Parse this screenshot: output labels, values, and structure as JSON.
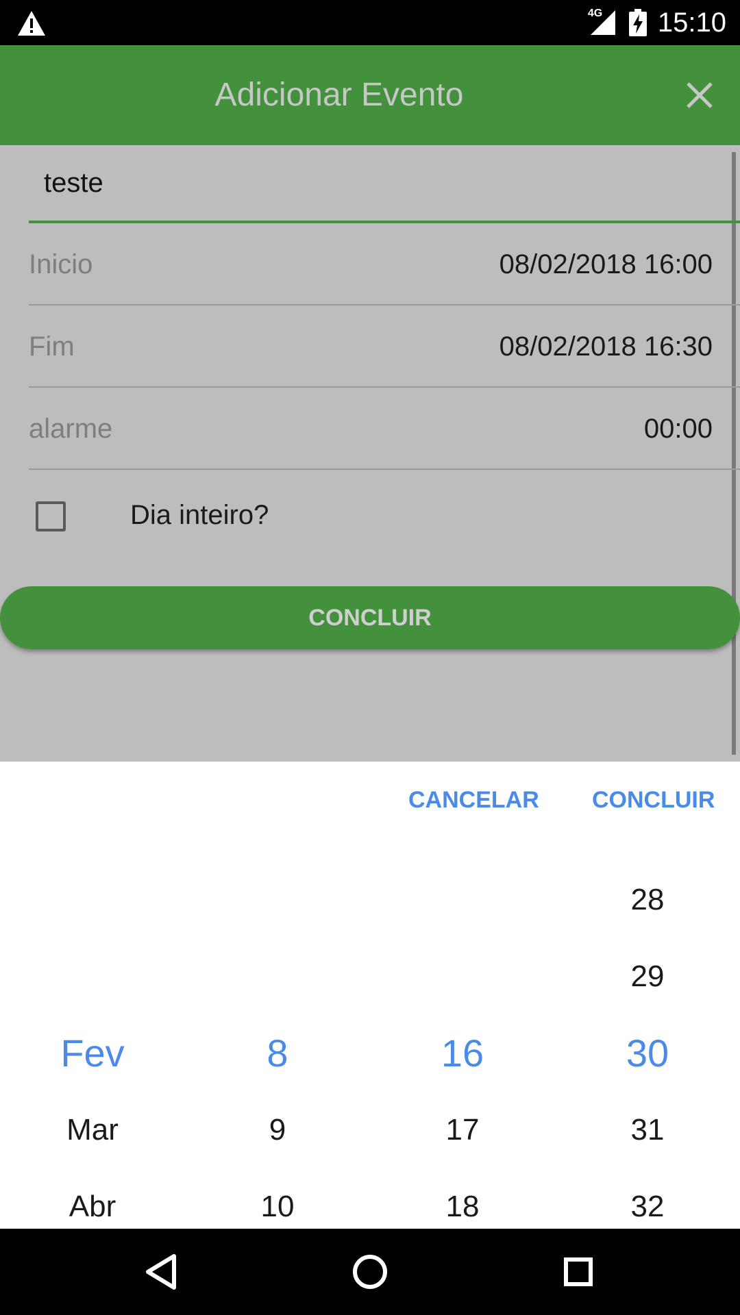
{
  "status_bar": {
    "network": "4G",
    "time": "15:10",
    "icons": [
      "warning-icon",
      "signal-icon",
      "battery-charging-icon"
    ]
  },
  "app_bar": {
    "title": "Adicionar Evento",
    "close_icon": "close-icon"
  },
  "form": {
    "title_value": "teste",
    "fields": [
      {
        "label": "Inicio",
        "value": "08/02/2018 16:00"
      },
      {
        "label": "Fim",
        "value": "08/02/2018 16:30"
      },
      {
        "label": "alarme",
        "value": "00:00"
      }
    ],
    "all_day": {
      "label": "Dia inteiro?",
      "checked": false
    },
    "submit_label": "CONCLUIR"
  },
  "picker": {
    "cancel_label": "CANCELAR",
    "confirm_label": "CONCLUIR",
    "columns": [
      {
        "rows": [
          "",
          "",
          "Fev",
          "Mar",
          "Abr"
        ],
        "selected_index": 2
      },
      {
        "rows": [
          "",
          "",
          "8",
          "9",
          "10"
        ],
        "selected_index": 2
      },
      {
        "rows": [
          "",
          "",
          "16",
          "17",
          "18"
        ],
        "selected_index": 2
      },
      {
        "rows": [
          "28",
          "29",
          "30",
          "31",
          "32"
        ],
        "selected_index": 2
      }
    ]
  },
  "nav_bar": {
    "icons": [
      "back-icon",
      "home-icon",
      "recents-icon"
    ]
  },
  "colors": {
    "primary": "#43913c",
    "accent": "#4a8ae8",
    "overlay": "#bdbdbd"
  }
}
